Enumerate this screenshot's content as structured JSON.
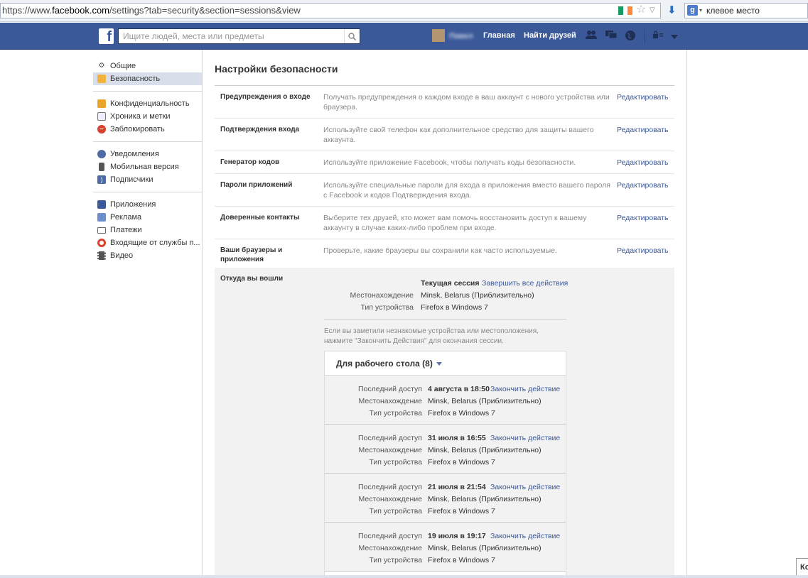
{
  "browser": {
    "url_prefix": "https://www.",
    "url_host": "facebook.com",
    "url_rest": "/settings?tab=security&section=sessions&view",
    "search_value": "клевое место"
  },
  "fb": {
    "search_placeholder": "Ищите людей, места или предметы",
    "username": "Павел",
    "nav_home": "Главная",
    "nav_find_friends": "Найти друзей"
  },
  "sidebar": {
    "items": [
      {
        "label": "Общие"
      },
      {
        "label": "Безопасность"
      },
      {
        "label": "Конфиденциальность"
      },
      {
        "label": "Хроника и метки"
      },
      {
        "label": "Заблокировать"
      },
      {
        "label": "Уведомления"
      },
      {
        "label": "Мобильная версия"
      },
      {
        "label": "Подписчики"
      },
      {
        "label": "Приложения"
      },
      {
        "label": "Реклама"
      },
      {
        "label": "Платежи"
      },
      {
        "label": "Входящие от службы п..."
      },
      {
        "label": "Видео"
      }
    ]
  },
  "main": {
    "title": "Настройки безопасности",
    "edit_label": "Редактировать",
    "rows": [
      {
        "label": "Предупреждения о входе",
        "desc": "Получать предупреждения о каждом входе в ваш аккаунт с нового устройства или браузера."
      },
      {
        "label": "Подтверждения входа",
        "desc": "Используйте свой телефон как дополнительное средство для защиты вашего аккаунта."
      },
      {
        "label": "Генератор кодов",
        "desc": "Используйте приложение Facebook, чтобы получать коды безопасности."
      },
      {
        "label": "Пароли приложений",
        "desc": "Используйте специальные пароли для входа в приложения вместо вашего пароля с Facebook и кодов Подтверждения входа."
      },
      {
        "label": "Доверенные контакты",
        "desc": "Выберите тех друзей, кто может вам помочь восстановить доступ к вашему аккаунту в случае каких-либо проблем при входе."
      },
      {
        "label": "Ваши браузеры и приложения",
        "desc": "Проверьте, какие браузеры вы сохранили как часто используемые."
      }
    ],
    "sessions": {
      "label": "Откуда вы вошли",
      "current_title": "Текущая сессия",
      "end_all": "Завершить все действия",
      "location_key": "Местонахождение",
      "location_value": "Minsk, Belarus (Приблизительно)",
      "device_key": "Тип устройства",
      "device_value": "Firefox в Windows 7",
      "note": "Если вы заметили незнакомые устройства или местоположения, нажмите \"Закончить Действия\" для окончания сессии.",
      "desktop_title": "Для рабочего стола (8)",
      "last_access_key": "Последний доступ",
      "end_action": "Закончить действие",
      "entries": [
        {
          "last_access": "4 августа в 18:50",
          "location": "Minsk, Belarus (Приблизительно)",
          "device": "Firefox в Windows 7"
        },
        {
          "last_access": "31 июля в 16:55",
          "location": "Minsk, Belarus (Приблизительно)",
          "device": "Firefox в Windows 7"
        },
        {
          "last_access": "21 июля в 21:54",
          "location": "Minsk, Belarus (Приблизительно)",
          "device": "Firefox в Windows 7"
        },
        {
          "last_access": "19 июля в 19:17",
          "location": "Minsk, Belarus (Приблизительно)",
          "device": "Firefox в Windows 7"
        }
      ]
    }
  },
  "corner_tab": "Ко"
}
